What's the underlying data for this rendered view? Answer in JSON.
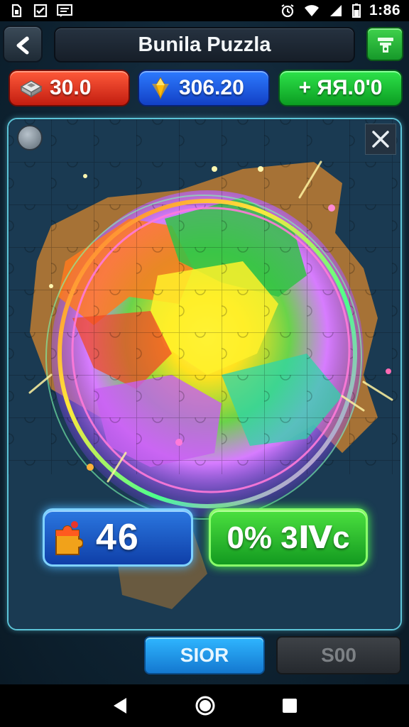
{
  "status_bar": {
    "time": "1:86",
    "left_icons": [
      "sim-icon",
      "checkbox-icon",
      "message-icon"
    ],
    "right_icons": [
      "alarm-icon",
      "wifi-icon",
      "signal-icon",
      "battery-icon"
    ]
  },
  "header": {
    "title": "Bunila Puzzla",
    "back_icon": "back-arrow-icon",
    "shop_icon": "shop-icon"
  },
  "resources": {
    "coins": "30.0",
    "gems": "306.20",
    "bonus": "+ ЯЯ.0'0"
  },
  "puzzle": {
    "pieces_count": "46",
    "progress": "0% 3Ⅳc"
  },
  "buttons": {
    "store_label": "SIOR",
    "disabled_label": "S00"
  },
  "colors": {
    "accent_blue": "#2f9bff",
    "accent_green": "#2de34a",
    "accent_red": "#e5301f",
    "panel_border": "#5cc4d8"
  }
}
